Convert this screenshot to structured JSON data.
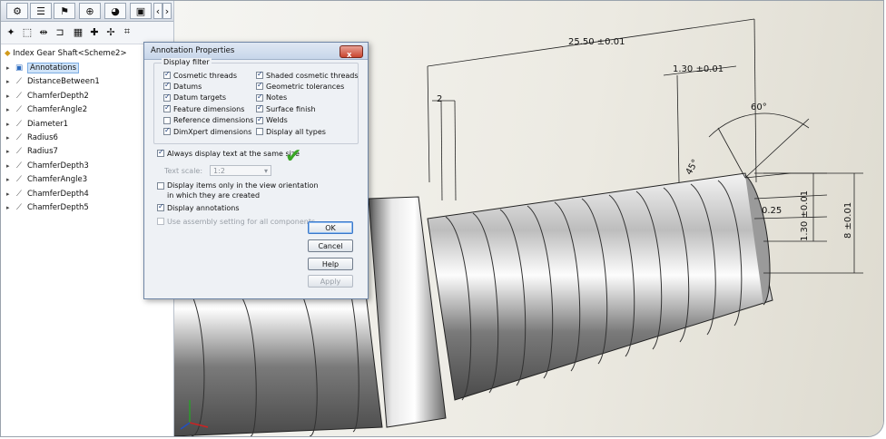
{
  "tree": {
    "root_label": "Index Gear Shaft<Scheme2>",
    "items": [
      {
        "label": "Annotations",
        "selected": true
      },
      {
        "label": "DistanceBetween1"
      },
      {
        "label": "ChamferDepth2"
      },
      {
        "label": "ChamferAngle2"
      },
      {
        "label": "Diameter1"
      },
      {
        "label": "Radius6"
      },
      {
        "label": "Radius7"
      },
      {
        "label": "ChamferDepth3"
      },
      {
        "label": "ChamferAngle3"
      },
      {
        "label": "ChamferDepth4"
      },
      {
        "label": "ChamferDepth5"
      }
    ]
  },
  "dialog": {
    "title": "Annotation Properties",
    "close_label": "x",
    "filter_group_label": "Display filter",
    "filters_left": [
      {
        "label": "Cosmetic threads",
        "checked": true
      },
      {
        "label": "Datums",
        "checked": true
      },
      {
        "label": "Datum targets",
        "checked": true
      },
      {
        "label": "Feature dimensions",
        "checked": true
      },
      {
        "label": "Reference dimensions",
        "checked": false
      },
      {
        "label": "DimXpert dimensions",
        "checked": true
      }
    ],
    "filters_right": [
      {
        "label": "Shaded cosmetic threads",
        "checked": true
      },
      {
        "label": "Geometric tolerances",
        "checked": true
      },
      {
        "label": "Notes",
        "checked": true
      },
      {
        "label": "Surface finish",
        "checked": true
      },
      {
        "label": "Welds",
        "checked": true
      },
      {
        "label": "Display all types",
        "checked": false
      }
    ],
    "always_same_size": "Always display text at the same size",
    "text_scale_label": "Text scale:",
    "text_scale_value": "1:2",
    "display_view_orientation": "Display items only in the view orientation in which they are created",
    "display_annotations": "Display annotations",
    "use_assembly": "Use assembly setting for all components",
    "ok": "OK",
    "cancel": "Cancel",
    "help": "Help",
    "apply": "Apply"
  },
  "dimensions": {
    "overall_length": "25.50 ±0.01",
    "thread_start": "1.30 ±0.01",
    "angle": "60°",
    "chamfer_angle": "45°",
    "groove": "2",
    "depth": "0.25",
    "height_small": "1.30 ±0.01",
    "height_large": "8 ±0.01"
  },
  "colors": {
    "accent": "#3b78c9",
    "check_green": "#3aa626",
    "close_red": "#c9452f"
  }
}
